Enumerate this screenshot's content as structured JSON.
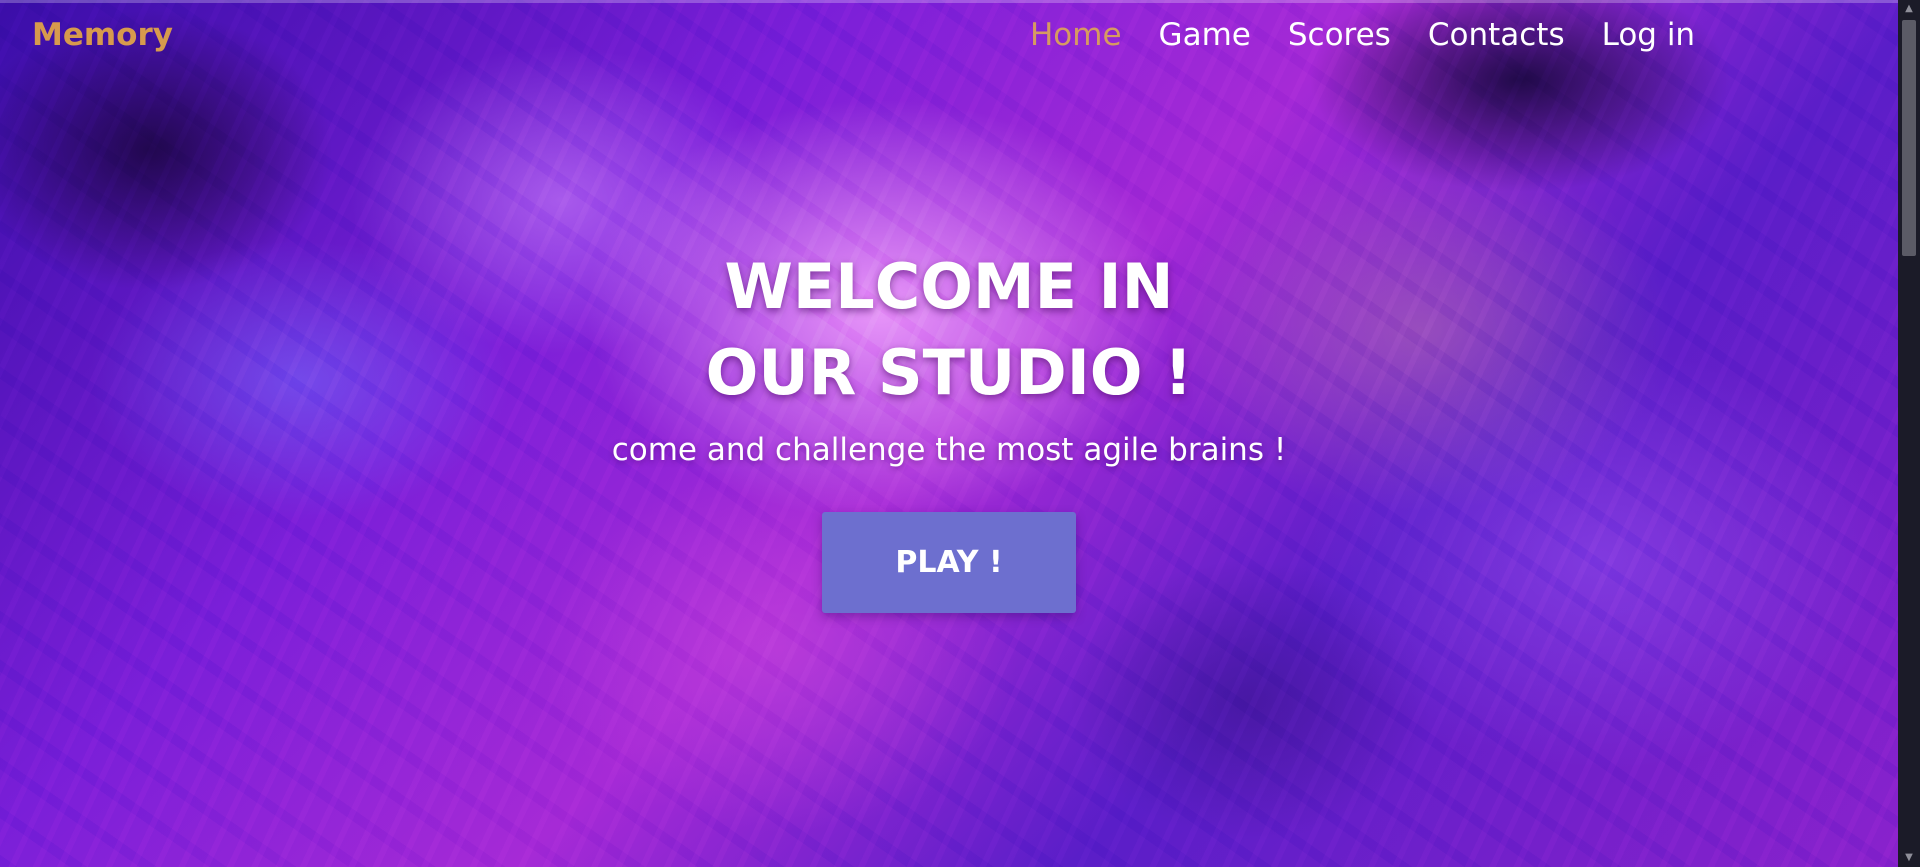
{
  "navbar": {
    "brand": "Memory",
    "links": [
      {
        "label": "Home",
        "active": true
      },
      {
        "label": "Game",
        "active": false
      },
      {
        "label": "Scores",
        "active": false
      },
      {
        "label": "Contacts",
        "active": false
      },
      {
        "label": "Log in",
        "active": false
      }
    ]
  },
  "hero": {
    "title_line1": "WELCOME IN",
    "title_line2": "OUR STUDIO !",
    "subtitle": "come and challenge the most agile brains !",
    "cta_label": "PLAY !"
  },
  "colors": {
    "brand": "#d79a4d",
    "active_link": "#d69a61",
    "button": "#6d6fcf",
    "text": "#ffffff"
  },
  "icons": {
    "scroll_up": "chevron-up-icon",
    "scroll_down": "chevron-down-icon"
  }
}
